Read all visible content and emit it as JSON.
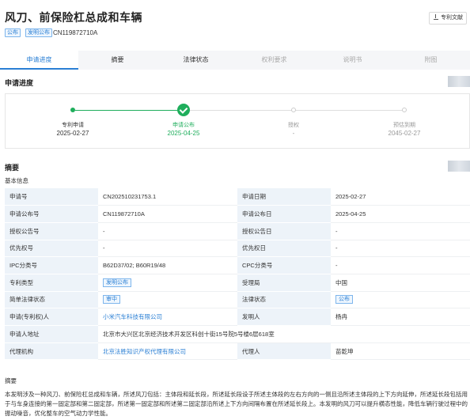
{
  "header": {
    "title": "风刀、前保险杠总成和车辆",
    "tags": [
      "公布",
      "发明公布"
    ],
    "publication_no": "CN119872710A",
    "doc_button": "专利文献"
  },
  "tabs": [
    {
      "label": "申请进度",
      "state": "active"
    },
    {
      "label": "摘要",
      "state": "normal"
    },
    {
      "label": "法律状态",
      "state": "normal"
    },
    {
      "label": "权利要求",
      "state": "disabled"
    },
    {
      "label": "说明书",
      "state": "disabled"
    },
    {
      "label": "附图",
      "state": "disabled"
    }
  ],
  "progress": {
    "title": "申请进度",
    "steps": [
      {
        "label": "专利申请",
        "date": "2025-02-27",
        "status": "done"
      },
      {
        "label": "申请公布",
        "date": "2025-04-25",
        "status": "current"
      },
      {
        "label": "授权",
        "date": "-",
        "status": "pending"
      },
      {
        "label": "预估到期",
        "date": "2045-02-27",
        "status": "pending"
      }
    ]
  },
  "abstract_section": {
    "title": "摘要",
    "basic_info": "基本信息"
  },
  "info_rows": [
    {
      "l1": "申请号",
      "v1": "CN202510231753.1",
      "l2": "申请日期",
      "v2": "2025-02-27"
    },
    {
      "l1": "申请公布号",
      "v1": "CN119872710A",
      "l2": "申请公布日",
      "v2": "2025-04-25"
    },
    {
      "l1": "授权公告号",
      "v1": "-",
      "l2": "授权公告日",
      "v2": "-"
    },
    {
      "l1": "优先权号",
      "v1": "-",
      "l2": "优先权日",
      "v2": "-"
    },
    {
      "l1": "IPC分类号",
      "v1": "B62D37/02;  B60R19/48",
      "l2": "CPC分类号",
      "v2": "-"
    },
    {
      "l1": "专利类型",
      "v1": "发明公布",
      "l2": "受理局",
      "v2": "中国"
    },
    {
      "l1": "简单法律状态",
      "v1": "审中",
      "l2": "法律状态",
      "v2": "公布"
    },
    {
      "l1": "申请(专利权)人",
      "v1": "小米汽车科技有限公司",
      "l2": "发明人",
      "v2": "杨冉"
    },
    {
      "l1": "申请人地址",
      "v1": "北京市大兴区北京经济技术开发区科创十街15号院5号楼6层618室"
    },
    {
      "l1": "代理机构",
      "v1": "北京法胜知识产权代理有限公司",
      "l2": "代理人",
      "v2": "苗乾坤"
    }
  ],
  "abstract": {
    "label": "摘要",
    "text": "本发明涉及一种风刀、前保险杠总成和车辆，所述风刀包括：主体段和延长段，所述延长段设于所述主体段的左右方向的一侧且沿所述主体段的上下方向延伸，所述延长段包括用于与车身连接的第一固定部和第二固定部，所述第一固定部和所述第二固定部沿所述上下方向间隔布置在所述延长段上。本发明的风刀可以提升横态性能，降低车辆行驶过程中的振动噪音，优化整车的空气动力学性能。"
  }
}
